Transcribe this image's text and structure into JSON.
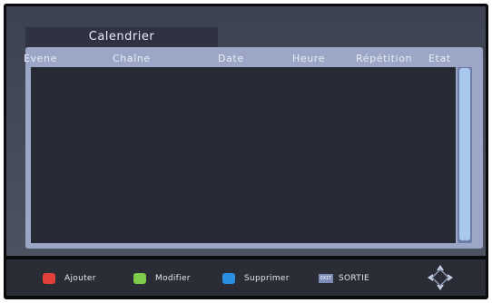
{
  "window": {
    "title": "Calendrier"
  },
  "table": {
    "columns": [
      "Evene",
      "Chaîne",
      "Date",
      "Heure",
      "Répétition",
      "Etat"
    ],
    "rows": []
  },
  "footer": {
    "keys": [
      {
        "label": "Ajouter",
        "color": "#e2403a"
      },
      {
        "label": "Modifier",
        "color": "#7ecb4a"
      },
      {
        "label": "Supprimer",
        "color": "#2a8fe0"
      }
    ],
    "exit_badge": "EXIT",
    "exit_label": "SORTIE",
    "nav_icon": "directional-pad-icon"
  },
  "colors": {
    "panel_background": "#4a4f5c",
    "list_frame": "#9ca6c6",
    "list_background": "#272a35",
    "scrollbar": "#a9c8ee"
  }
}
